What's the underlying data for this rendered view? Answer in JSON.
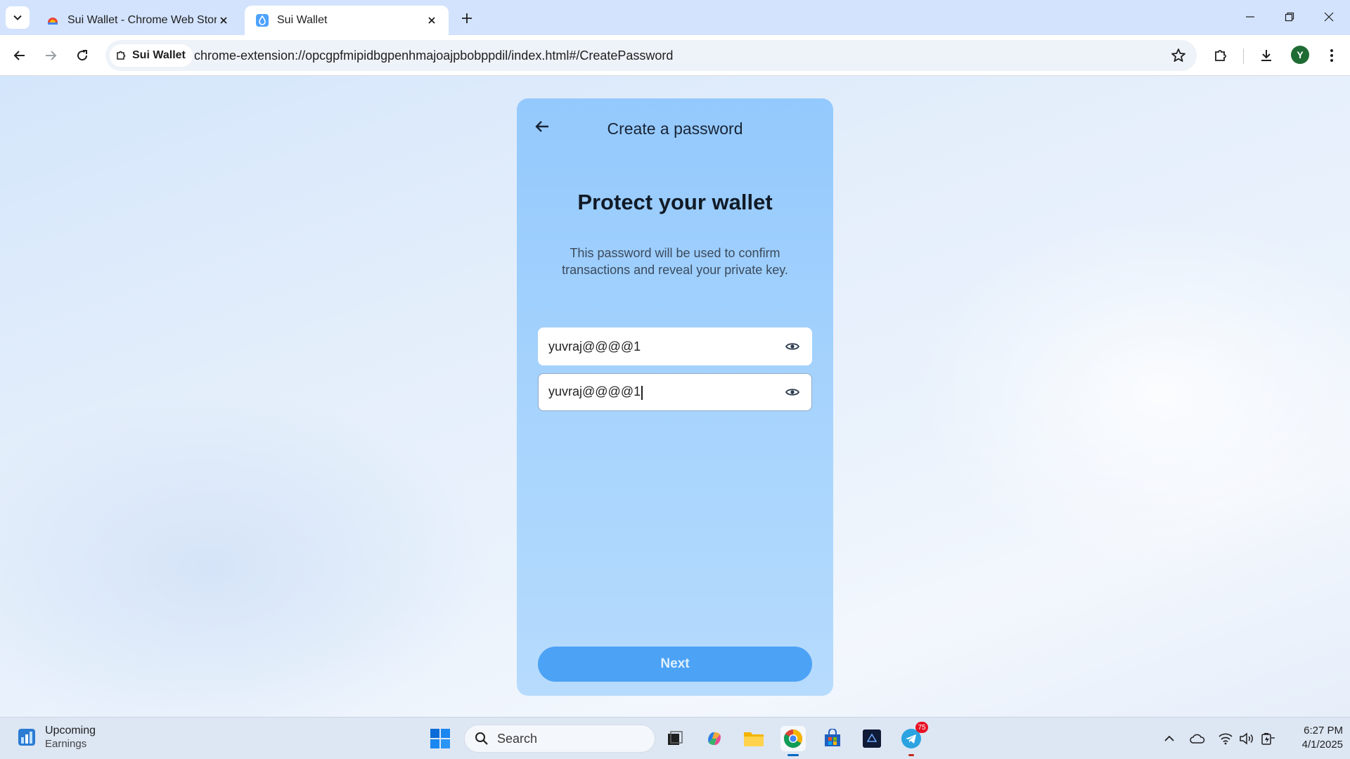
{
  "browser": {
    "tabs": [
      {
        "title": "Sui Wallet - Chrome Web Store",
        "active": false
      },
      {
        "title": "Sui Wallet",
        "active": true
      }
    ],
    "site_chip": "Sui Wallet",
    "url": "chrome-extension://opcgpfmipidbgpenhmajoajpbobppdil/index.html#/CreatePassword",
    "profile_initial": "Y"
  },
  "wallet": {
    "header_title": "Create a password",
    "headline": "Protect your wallet",
    "subtext": "This password will be used to confirm transactions and reveal your private key.",
    "password_value": "yuvraj@@@@1",
    "confirm_password_value": "yuvraj@@@@1",
    "next_label": "Next",
    "colors": {
      "card": "#a6d3fd",
      "button": "#4ca2f5"
    }
  },
  "taskbar": {
    "weather_title": "Upcoming",
    "weather_subtitle": "Earnings",
    "search_placeholder": "Search",
    "telegram_badge": "75",
    "time": "6:27 PM",
    "date": "4/1/2025"
  }
}
